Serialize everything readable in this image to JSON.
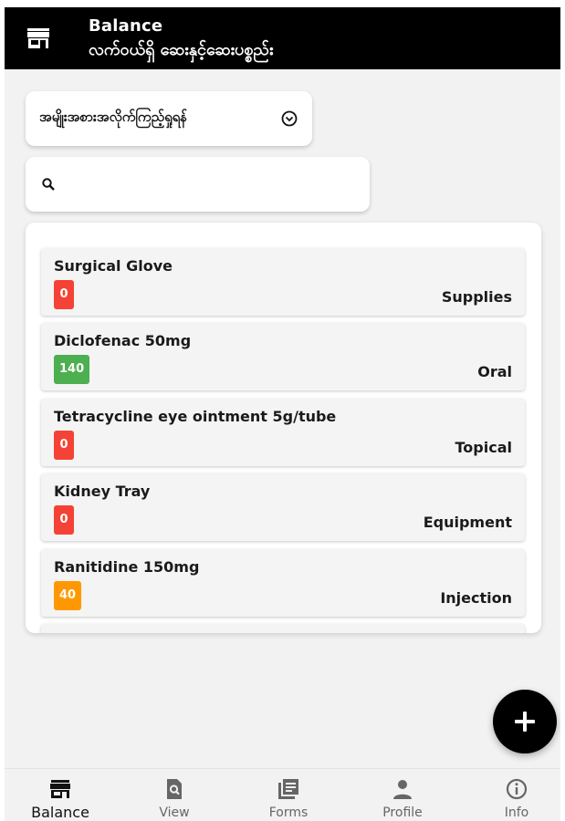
{
  "header": {
    "title": "Balance",
    "subtitle": "လက်ဝယ်ရှိ ဆေးနှင့်ဆေးပစ္စည်း",
    "icon": "store-icon"
  },
  "filter": {
    "label": "အမျိုးအစားအလိုက်ကြည့်ရှုရန်",
    "icon": "chevron-down-circle-icon"
  },
  "search": {
    "icon": "search-icon",
    "value": "",
    "placeholder": ""
  },
  "items": [
    {
      "name": "Surgical Glove",
      "quantity": "0",
      "category": "Supplies",
      "badge_color": "#f44336"
    },
    {
      "name": "Diclofenac 50mg",
      "quantity": "140",
      "category": "Oral",
      "badge_color": "#4caf50"
    },
    {
      "name": "Tetracycline eye ointment 5g/tube",
      "quantity": "0",
      "category": "Topical",
      "badge_color": "#f44336"
    },
    {
      "name": "Kidney Tray",
      "quantity": "0",
      "category": "Equipment",
      "badge_color": "#f44336"
    },
    {
      "name": "Ranitidine 150mg",
      "quantity": "40",
      "category": "Injection",
      "badge_color": "#ff9800"
    }
  ],
  "fab": {
    "icon": "plus-icon"
  },
  "nav": {
    "active": "Balance",
    "items": [
      {
        "label": "Balance",
        "icon": "store-icon"
      },
      {
        "label": "View",
        "icon": "search-document-icon"
      },
      {
        "label": "Forms",
        "icon": "forms-icon"
      },
      {
        "label": "Profile",
        "icon": "person-icon"
      },
      {
        "label": "Info",
        "icon": "info-icon"
      }
    ]
  }
}
